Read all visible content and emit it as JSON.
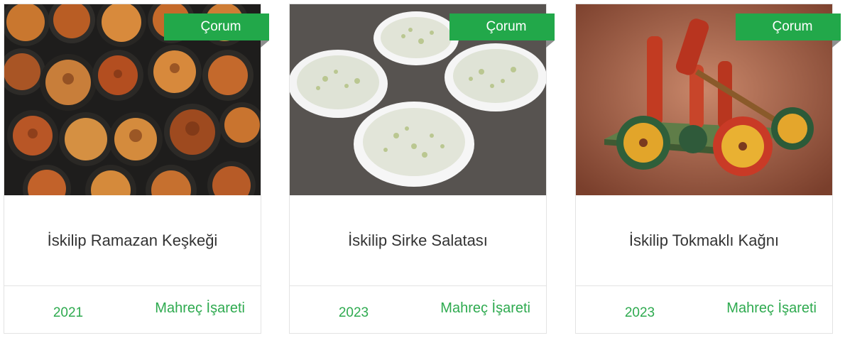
{
  "cards": [
    {
      "location": "Çorum",
      "title": "İskilip Ramazan Keşkeği",
      "year": "2021",
      "category": "Mahreç İşareti",
      "image_subject": "clay pots of baked keşkek"
    },
    {
      "location": "Çorum",
      "title": "İskilip Sirke Salatası",
      "year": "2023",
      "category": "Mahreç İşareti",
      "image_subject": "bowls of vinegar salad"
    },
    {
      "location": "Çorum",
      "title": "İskilip Tokmaklı Kağnı",
      "year": "2023",
      "category": "Mahreç İşareti",
      "image_subject": "wooden toy ox cart"
    }
  ],
  "colors": {
    "accent_green": "#22a84a",
    "footer_text_green": "#2eaa4f",
    "title_text": "#333333",
    "border": "#e3e3e3"
  }
}
